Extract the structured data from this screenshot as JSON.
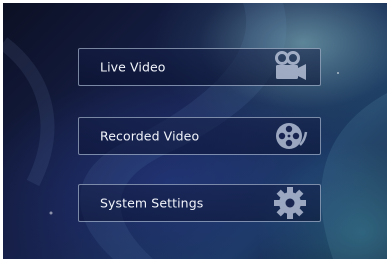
{
  "menu": {
    "items": [
      {
        "label": "Live Video",
        "icon": "video-camera-icon"
      },
      {
        "label": "Recorded Video",
        "icon": "film-reel-icon"
      },
      {
        "label": "System Settings",
        "icon": "gear-icon"
      }
    ]
  },
  "colors": {
    "background_dark": "#0c1024",
    "background_blue": "#1b3a62",
    "button_border": "#d2e1f5",
    "label_text": "#f2f5fb"
  }
}
